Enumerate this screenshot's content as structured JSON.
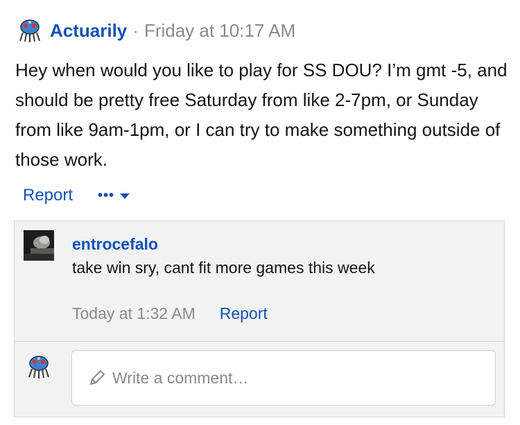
{
  "post": {
    "author": "Actuarily",
    "separator": "·",
    "timestamp": "Friday at 10:17 AM",
    "body": "Hey when would you like to play for SS DOU? I’m gmt -5, and should be pretty free Saturday from like 2-7pm, or Sunday from like 9am-1pm, or I can try to make something outside of those work.",
    "report_label": "Report",
    "more_label": "•••"
  },
  "comment": {
    "author": "entrocefalo",
    "text": "take win sry, cant fit more games this week",
    "timestamp": "Today at 1:32 AM",
    "report_label": "Report"
  },
  "reply": {
    "placeholder": "Write a comment…"
  },
  "icons": {
    "post_avatar": "tentacool-avatar-icon",
    "comment_avatar": "dark-photo-avatar",
    "pencil": "pencil-icon",
    "more_caret": "chevron-down-icon"
  },
  "colors": {
    "link": "#1250b8",
    "muted": "#8a8a8a",
    "comment_bg": "#f2f2f2"
  }
}
